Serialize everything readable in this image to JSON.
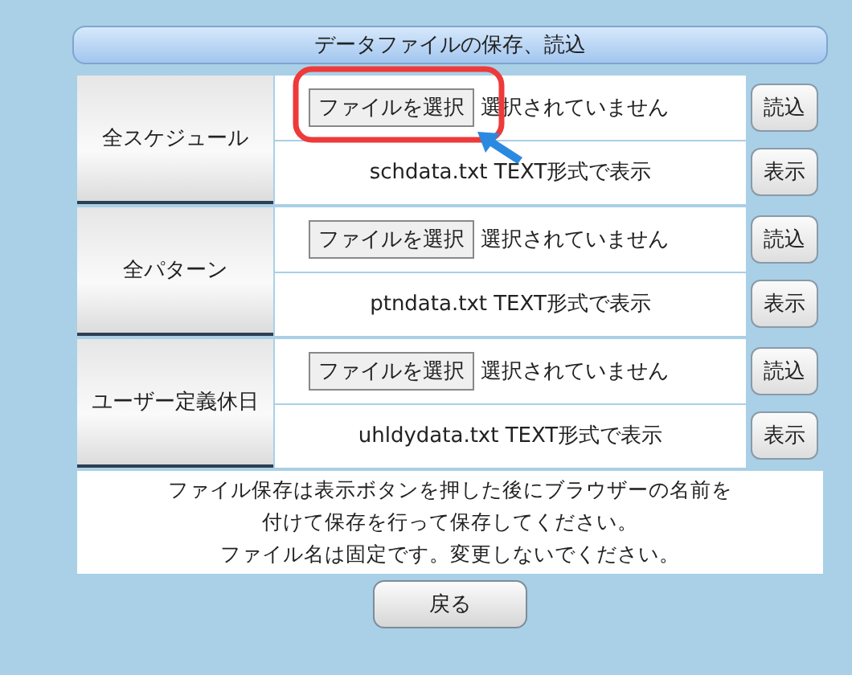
{
  "header": {
    "title": "データファイルの保存、読込"
  },
  "sections": [
    {
      "label": "全スケジュール",
      "file_button": "ファイルを選択",
      "file_status": "選択されていません",
      "load_button": "読込",
      "view_text": "schdata.txt TEXT形式で表示",
      "view_button": "表示",
      "highlighted": true
    },
    {
      "label": "全パターン",
      "file_button": "ファイルを選択",
      "file_status": "選択されていません",
      "load_button": "読込",
      "view_text": "ptndata.txt TEXT形式で表示",
      "view_button": "表示",
      "highlighted": false
    },
    {
      "label": "ユーザー定義休日",
      "file_button": "ファイルを選択",
      "file_status": "選択されていません",
      "load_button": "読込",
      "view_text": "uhldydata.txt TEXT形式で表示",
      "view_button": "表示",
      "highlighted": false
    }
  ],
  "note": [
    "ファイル保存は表示ボタンを押した後にブラウザーの名前を",
    "付けて保存を行って保存してください。",
    "ファイル名は固定です。変更しないでください。"
  ],
  "back_button": "戻る"
}
